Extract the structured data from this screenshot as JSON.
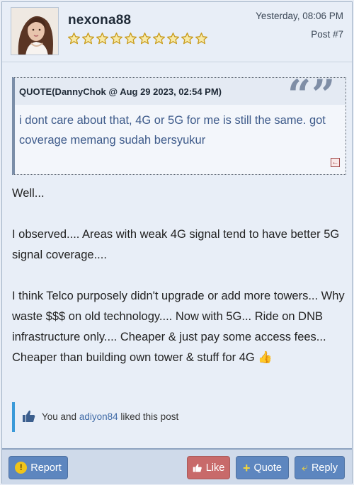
{
  "post": {
    "username": "nexona88",
    "rating_stars": 10,
    "timestamp": "Yesterday, 08:06 PM",
    "post_number": "Post #7",
    "avatar": "profile-photo"
  },
  "quote": {
    "author_line": "QUOTE(DannyChok @ Aug 29 2023, 02:54 PM)",
    "text": "i dont care about that, 4G or 5G for me is still the same. got coverage memang sudah bersyukur",
    "jump_icon": "back-arrow-icon"
  },
  "body": {
    "paragraphs": [
      "Well...",
      "I observed.... Areas with weak 4G signal tend to have better 5G signal coverage....",
      "I think Telco purposely didn't upgrade or add more towers... Why waste $$$ on old technology.... Now with 5G... Ride on DNB infrastructure only.... Cheaper & just pay some access fees... Cheaper than building own tower & stuff for 4G 👍"
    ]
  },
  "likes": {
    "prefix": "You and",
    "user": "adiyon84",
    "suffix": "liked this post"
  },
  "actions": {
    "report": "Report",
    "like": "Like",
    "quote": "Quote",
    "reply": "Reply"
  },
  "colors": {
    "background": "#e8eef7",
    "accent_blue": "#5d86bf",
    "like_red": "#c86a6a",
    "quote_text": "#3d5a8a"
  }
}
